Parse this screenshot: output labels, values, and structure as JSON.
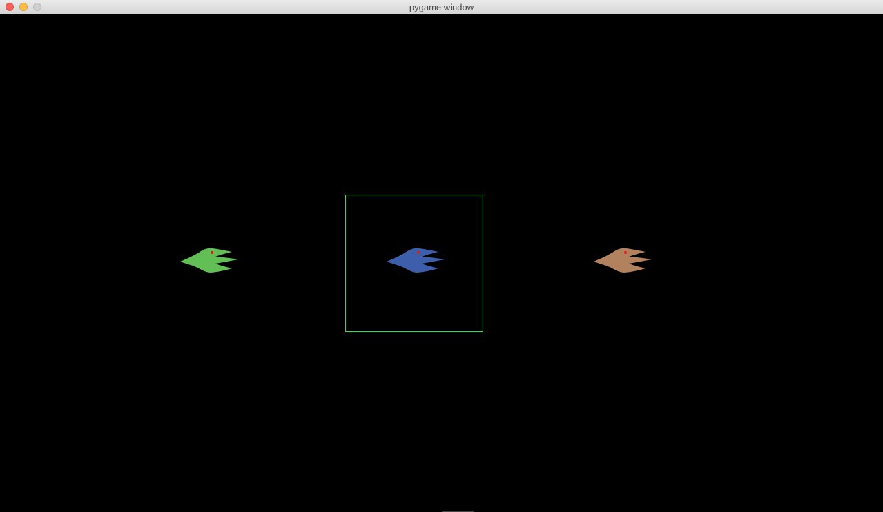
{
  "window": {
    "title": "pygame window",
    "controls": [
      "close-icon",
      "minimize-icon",
      "zoom-icon"
    ]
  },
  "scene": {
    "background": "#000000",
    "selection_color": "#22e844",
    "selected_ship": "blue",
    "ships": [
      {
        "name": "green",
        "color": "#61bf55",
        "eye_color": "#e01b1b"
      },
      {
        "name": "blue",
        "color": "#3d5fab",
        "eye_color": "#e01b1b"
      },
      {
        "name": "tan",
        "color": "#b2825e",
        "eye_color": "#e01b1b"
      }
    ]
  }
}
